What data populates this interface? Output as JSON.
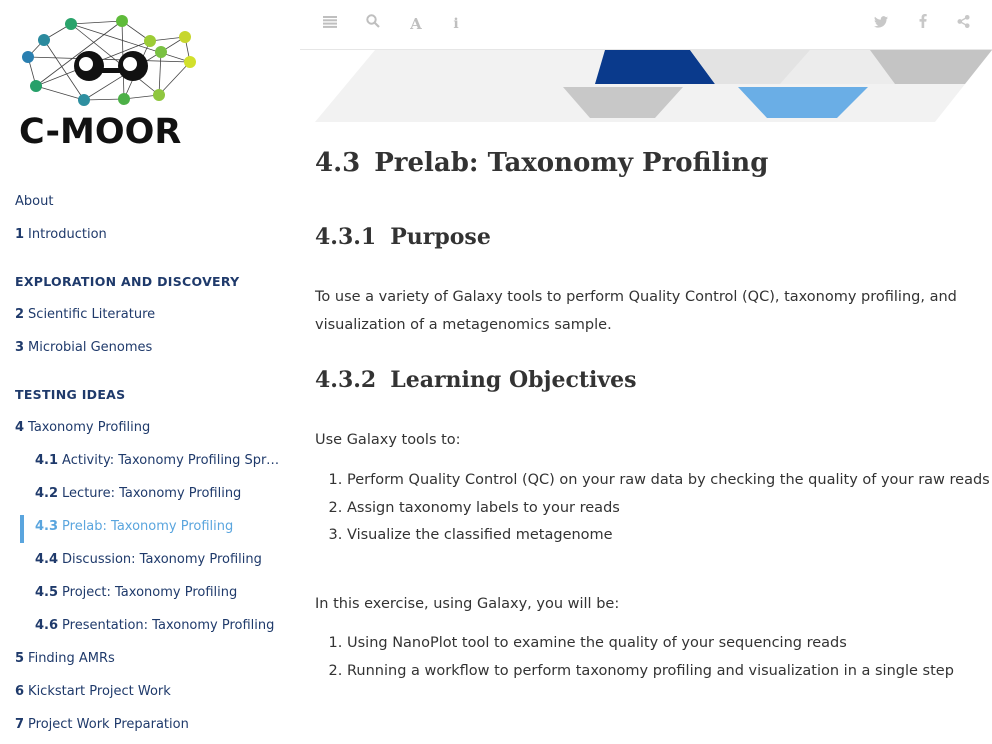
{
  "logo": {
    "text": "C-MOOR"
  },
  "toolbar": {
    "left_icons": [
      "menu-icon",
      "search-icon",
      "font-icon",
      "info-icon"
    ],
    "right_icons": [
      "twitter-icon",
      "facebook-icon",
      "share-icon"
    ]
  },
  "sidebar": {
    "about": "About",
    "intro": {
      "num": "1",
      "label": "Introduction"
    },
    "part1": "EXPLORATION AND DISCOVERY",
    "ch2": {
      "num": "2",
      "label": "Scientific Literature"
    },
    "ch3": {
      "num": "3",
      "label": "Microbial Genomes"
    },
    "part2": "TESTING IDEAS",
    "ch4": {
      "num": "4",
      "label": "Taxonomy Profiling"
    },
    "s41": {
      "num": "4.1",
      "label": "Activity: Taxonomy Profiling Spreadsheet"
    },
    "s42": {
      "num": "4.2",
      "label": "Lecture: Taxonomy Profiling"
    },
    "s43": {
      "num": "4.3",
      "label": "Prelab: Taxonomy Profiling"
    },
    "s44": {
      "num": "4.4",
      "label": "Discussion: Taxonomy Profiling"
    },
    "s45": {
      "num": "4.5",
      "label": "Project: Taxonomy Profiling"
    },
    "s46": {
      "num": "4.6",
      "label": "Presentation: Taxonomy Profiling"
    },
    "ch5": {
      "num": "5",
      "label": "Finding AMRs"
    },
    "ch6": {
      "num": "6",
      "label": "Kickstart Project Work"
    },
    "ch7": {
      "num": "7",
      "label": "Project Work Preparation"
    }
  },
  "main": {
    "title": {
      "num": "4.3",
      "text": "Prelab: Taxonomy Profiling"
    },
    "purpose": {
      "num": "4.3.1",
      "text": "Purpose"
    },
    "purpose_text": "To use a variety of Galaxy tools to perform Quality Control (QC), taxonomy profiling, and visualization of a metagenomics sample.",
    "objectives": {
      "num": "4.3.2",
      "text": "Learning Objectives"
    },
    "objectives_intro": "Use Galaxy tools to:",
    "objectives_list": [
      "Perform Quality Control (QC) on your raw data by checking the quality of your raw reads",
      "Assign taxonomy labels to your reads",
      "Visualize the classified metagenome"
    ],
    "exercise_intro": "In this exercise, using Galaxy, you will be:",
    "exercise_list": [
      "Using NanoPlot tool to examine the quality of your sequencing reads",
      "Running a workflow to perform taxonomy profiling and visualization in a single step"
    ]
  },
  "colors": {
    "nav_text": "#1f3a6b",
    "active": "#5aa5de",
    "banner_dark": "#0a3a8c",
    "banner_light": "#6aaee6"
  }
}
